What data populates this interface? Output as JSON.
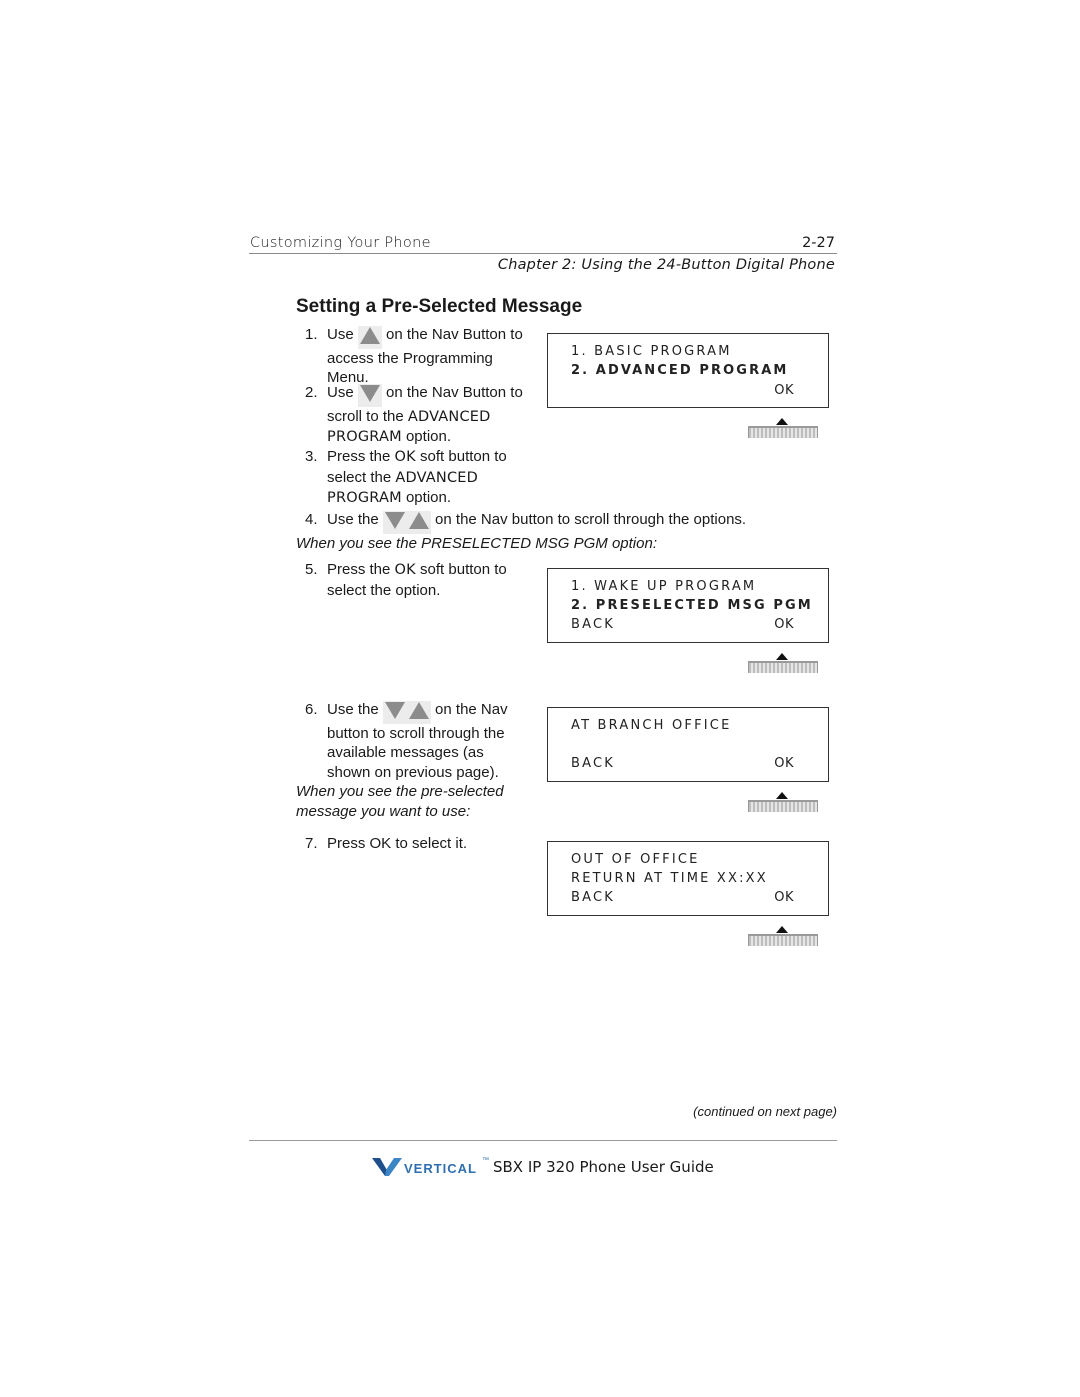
{
  "header": {
    "section": "Customizing Your Phone",
    "page_number": "2-27",
    "chapter": "Chapter 2: Using the 24-Button Digital Phone"
  },
  "title": "Setting a Pre-Selected Message",
  "steps": [
    {
      "num": "1.",
      "parts": [
        "Use",
        "on the Nav Button to",
        "access the Programming",
        "Menu."
      ],
      "icon": "nav-up"
    },
    {
      "num": "2.",
      "parts": [
        "Use",
        "on the Nav Button to",
        "scroll to the",
        "ADVANCED",
        "PROGRAM",
        "option."
      ],
      "icon": "nav-down"
    },
    {
      "num": "3.",
      "parts": [
        "Press the",
        "OK",
        "soft button to",
        "select the",
        "ADVANCED",
        "PROGRAM",
        "option."
      ]
    },
    {
      "num": "4.",
      "parts": [
        "Use the",
        "on the Nav button to scroll through the options."
      ],
      "icon": "nav-down-up"
    },
    {
      "num": "5.",
      "parts": [
        "Press the",
        "OK",
        "soft button to",
        "select the option."
      ]
    },
    {
      "num": "6.",
      "parts": [
        "Use the",
        "on the Nav",
        "button to scroll through the",
        "available messages (as",
        "shown on previous page)."
      ],
      "icon": "nav-down-up"
    },
    {
      "num": "7.",
      "parts": [
        "Press OK to select it."
      ]
    }
  ],
  "notes": {
    "preselected": "When you see the PRESELECTED MSG PGM option:",
    "pre_selected_line1": "When you see the pre-selected",
    "pre_selected_line2": "message you want to use:"
  },
  "displays": [
    {
      "line1": "1. BASIC PROGRAM",
      "line2": "2. ADVANCED PROGRAM",
      "left_soft": "",
      "right_soft": "OK"
    },
    {
      "line1": "1. WAKE UP PROGRAM",
      "line2": "2. PRESELECTED MSG PGM",
      "left_soft": "BACK",
      "right_soft": "OK"
    },
    {
      "line1": "AT BRANCH OFFICE",
      "line2": "",
      "left_soft": "BACK",
      "right_soft": "OK"
    },
    {
      "line1": "OUT OF OFFICE",
      "line2": "RETURN AT TIME XX:XX",
      "left_soft": "BACK",
      "right_soft": "OK"
    }
  ],
  "continued": "(continued on next page)",
  "footer": {
    "brand": "VERTICAL",
    "trademark": "™",
    "guide_title": "SBX IP 320 Phone User Guide",
    "brand_color": "#2f6fb0"
  }
}
